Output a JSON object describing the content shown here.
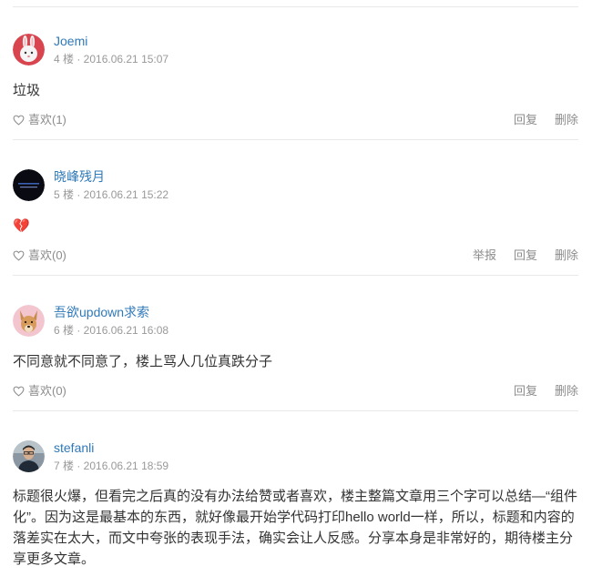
{
  "comments": [
    {
      "author": "Joemi",
      "meta": "4 楼 · 2016.06.21 15:07",
      "body": "垃圾",
      "like_label": "喜欢(1)",
      "actions": [
        "回复",
        "删除"
      ],
      "avatar_icon": "rabbit-avatar"
    },
    {
      "author": "晓峰残月",
      "meta": "5 楼 · 2016.06.21 15:22",
      "body": "💔",
      "like_label": "喜欢(0)",
      "actions": [
        "举报",
        "回复",
        "删除"
      ],
      "avatar_icon": "dark-text-avatar"
    },
    {
      "author": "吾欲updown求索",
      "meta": "6 楼 · 2016.06.21 16:08",
      "body": "不同意就不同意了，楼上骂人几位真跌分子",
      "like_label": "喜欢(0)",
      "actions": [
        "回复",
        "删除"
      ],
      "avatar_icon": "dog-avatar"
    },
    {
      "author": "stefanli",
      "meta": "7 楼 · 2016.06.21 18:59",
      "body": "标题很火爆，但看完之后真的没有办法给赞或者喜欢，楼主整篇文章用三个字可以总结—“组件化”。因为这是最基本的东西，就好像最开始学代码打印hello world一样，所以，标题和内容的落差实在太大，而文中夸张的表现手法，确实会让人反感。分享本身是非常好的，期待楼主分享更多文章。",
      "avatar_icon": "person-avatar"
    }
  ],
  "colors": {
    "author": "#2f79b8",
    "meta": "#999999",
    "divider": "#e8e8e8"
  }
}
